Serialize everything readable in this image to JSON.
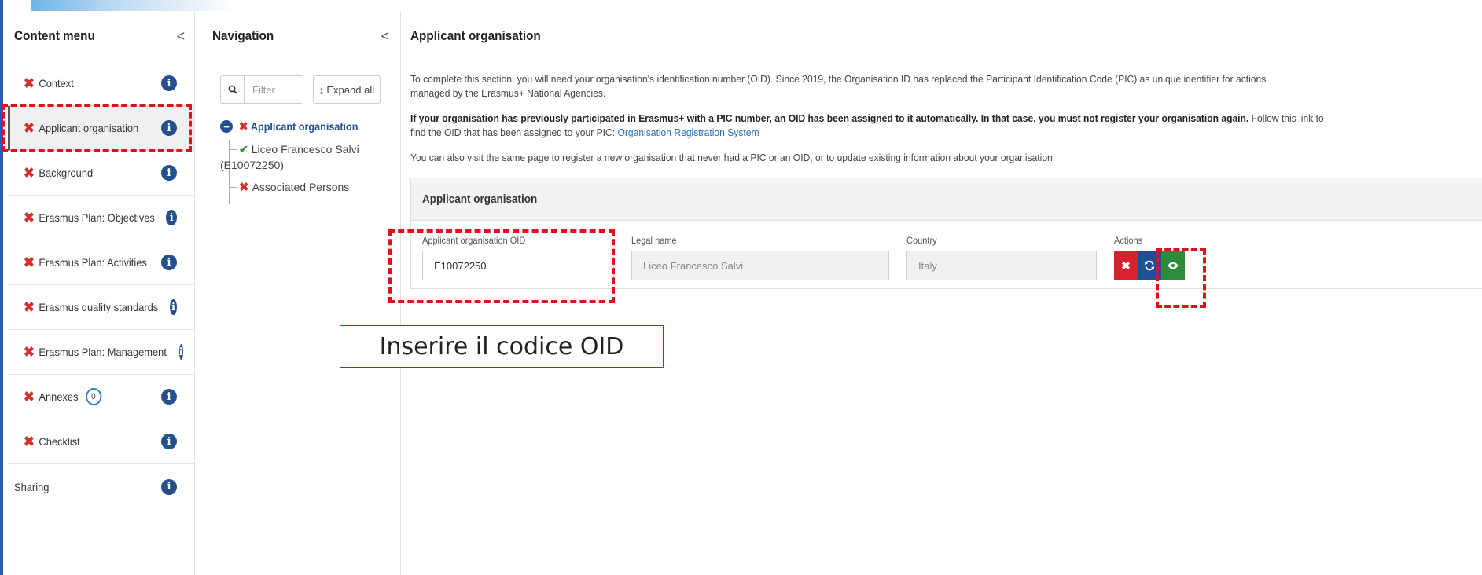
{
  "content_menu": {
    "title": "Content menu",
    "collapse_glyph": "<",
    "items": [
      {
        "label": "Context",
        "status": "x-mark-icon",
        "active": false
      },
      {
        "label": "Applicant organisation",
        "status": "x-mark-icon",
        "active": true
      },
      {
        "label": "Background",
        "status": "x-mark-icon",
        "active": false
      },
      {
        "label": "Erasmus Plan: Objectives",
        "status": "x-mark-icon",
        "active": false
      },
      {
        "label": "Erasmus Plan: Activities",
        "status": "x-mark-icon",
        "active": false
      },
      {
        "label": "Erasmus quality standards",
        "status": "x-mark-icon",
        "active": false
      },
      {
        "label": "Erasmus Plan: Management",
        "status": "x-mark-icon",
        "active": false
      },
      {
        "label": "Annexes",
        "status": "x-mark-icon",
        "active": false,
        "count": "0"
      },
      {
        "label": "Checklist",
        "status": "x-mark-icon",
        "active": false
      },
      {
        "label": "Sharing",
        "active": false
      }
    ],
    "info_glyph": "i"
  },
  "navigation": {
    "title": "Navigation",
    "collapse_glyph": "<",
    "filter_placeholder": "Filter",
    "expand_label": "Expand all",
    "expand_glyph": "↨",
    "tree": {
      "root": "Applicant organisation",
      "children": [
        "Liceo Francesco Salvi",
        "(E10072250)",
        "Associated Persons"
      ]
    }
  },
  "main": {
    "title": "Applicant organisation",
    "p1_line1": "To complete this section, you will need your organisation's identification number (OID). Since 2019, the Organisation ID has replaced the Participant Identification Code (PIC) as unique identifier for actions",
    "p1_line2": "managed by the Erasmus+ National Agencies.",
    "p2_bold": "If your organisation has previously participated in Erasmus+ with a PIC number, an OID has been assigned to it automatically. In that case, you must not register your organisation again.",
    "p2_rest": " Follow this link to",
    "p2_line2": "find the OID that has been assigned to your PIC: ",
    "p2_link": "Organisation Registration System",
    "p3": "You can also visit the same page to register a new organisation that never had a PIC or an OID, or to update existing information about your organisation.",
    "card": {
      "title": "Applicant organisation",
      "oid_label": "Applicant organisation OID",
      "oid_value": "E10072250",
      "legal_label": "Legal name",
      "legal_value": "Liceo Francesco Salvi",
      "country_label": "Country",
      "country_value": "Italy",
      "actions_label": "Actions"
    }
  },
  "annotation": {
    "callout_text": "Inserire il codice OID",
    "color": "#e0111b"
  }
}
